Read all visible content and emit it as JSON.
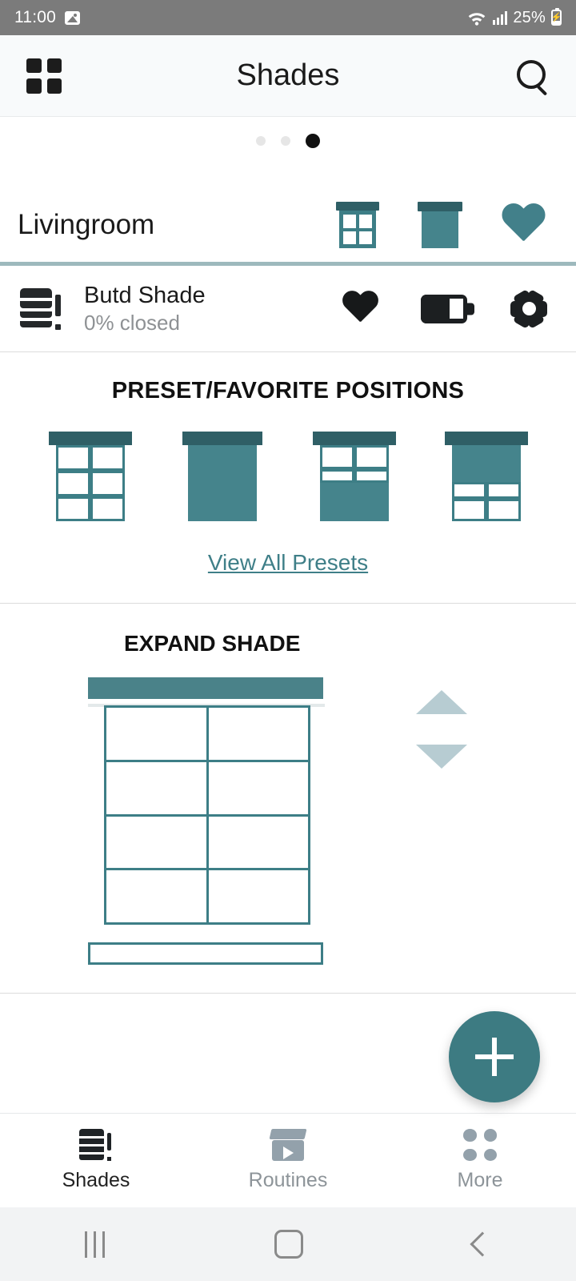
{
  "status_bar": {
    "time": "11:00",
    "battery_percent": "25%",
    "icons": [
      "image-icon",
      "wifi-icon",
      "cellular-signal-icon",
      "battery-charging-icon"
    ]
  },
  "app_bar": {
    "menu_icon": "grid-menu-icon",
    "title": "Shades",
    "search_icon": "search-icon"
  },
  "pager": {
    "total": 3,
    "active_index": 2
  },
  "room": {
    "name": "Livingroom",
    "actions": [
      {
        "name": "open-all-shades",
        "icon": "window-open-icon"
      },
      {
        "name": "close-all-shades",
        "icon": "shade-closed-icon"
      },
      {
        "name": "room-favorite",
        "icon": "heart-icon"
      }
    ]
  },
  "device": {
    "icon": "shade-stack-icon",
    "name": "Butd Shade",
    "status": "0% closed",
    "actions": [
      {
        "name": "favorite",
        "icon": "heart-filled-icon"
      },
      {
        "name": "battery",
        "icon": "battery-icon"
      },
      {
        "name": "settings",
        "icon": "gear-icon"
      }
    ]
  },
  "presets": {
    "title": "PRESET/FAVORITE POSITIONS",
    "items": [
      {
        "name": "preset-fully-open",
        "icon": "window-open-icon"
      },
      {
        "name": "preset-fully-closed",
        "icon": "shade-closed-icon"
      },
      {
        "name": "preset-bottom-closed",
        "icon": "shade-bottom-up-icon"
      },
      {
        "name": "preset-top-closed",
        "icon": "shade-top-down-icon"
      }
    ],
    "view_all_label": "View All Presets"
  },
  "expand": {
    "title": "EXPAND SHADE",
    "up_icon": "triangle-up-icon",
    "down_icon": "triangle-down-icon"
  },
  "fab": {
    "name": "add-button",
    "icon": "plus-icon"
  },
  "bottom_nav": {
    "items": [
      {
        "label": "Shades",
        "icon": "shade-stack-icon",
        "active": true
      },
      {
        "label": "Routines",
        "icon": "clapperboard-icon",
        "active": false
      },
      {
        "label": "More",
        "icon": "four-dots-icon",
        "active": false
      }
    ]
  },
  "android_nav": {
    "recents": "recents-icon",
    "home": "home-icon",
    "back": "back-icon"
  },
  "colors": {
    "teal": "#3d7e86",
    "teal_dark": "#2f5f66",
    "teal_fill": "#45848c",
    "arrow": "#b7ccd2",
    "status_bar": "#7b7b7b",
    "fab": "#3d7b82"
  }
}
